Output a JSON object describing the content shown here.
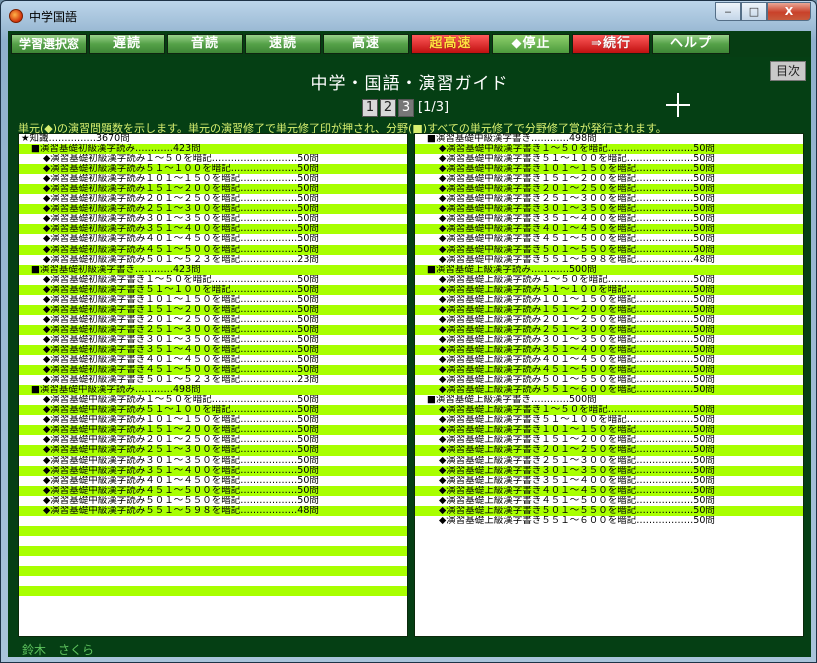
{
  "window": {
    "title": "中学国語",
    "min": "‒",
    "max": "□",
    "close": "X"
  },
  "toolbar": [
    "学習選択窓",
    "遅読",
    "音読",
    "速読",
    "高速",
    "超高速",
    "◆停止",
    "⇒続行",
    "ヘルプ"
  ],
  "heading": "中学・国語・演習ガイド",
  "next_label": "目次",
  "pages": [
    "1",
    "2",
    "3"
  ],
  "page_indicator": "[1/3]",
  "info": "単元(◆)の演習問題数を示します。単元の演習修了で単元修了印が押され、分野(■)すべての単元修了で分野修了賞が発行されます。",
  "left_rows": [
    {
      "t": "★知識……………3670問",
      "k": "cat",
      "h": false
    },
    {
      "t": "■演習基礎初級漢字読み…………423問",
      "k": "sec",
      "h": true
    },
    {
      "t": "◆演習基礎初級漢字読み１～５０を暗記………………………50問",
      "k": "item",
      "h": false
    },
    {
      "t": "◆演習基礎初級漢字読み５１～１００を暗記…………………50問",
      "k": "item",
      "h": true
    },
    {
      "t": "◆演習基礎初級漢字読み１０１～１５０を暗記………………50問",
      "k": "item",
      "h": false
    },
    {
      "t": "◆演習基礎初級漢字読み１５１～２００を暗記………………50問",
      "k": "item",
      "h": true
    },
    {
      "t": "◆演習基礎初級漢字読み２０１～２５０を暗記………………50問",
      "k": "item",
      "h": false
    },
    {
      "t": "◆演習基礎初級漢字読み２５１～３００を暗記………………50問",
      "k": "item",
      "h": true
    },
    {
      "t": "◆演習基礎初級漢字読み３０１～３５０を暗記………………50問",
      "k": "item",
      "h": false
    },
    {
      "t": "◆演習基礎初級漢字読み３５１～４００を暗記………………50問",
      "k": "item",
      "h": true
    },
    {
      "t": "◆演習基礎初級漢字読み４０１～４５０を暗記………………50問",
      "k": "item",
      "h": false
    },
    {
      "t": "◆演習基礎初級漢字読み４５１～５００を暗記………………50問",
      "k": "item",
      "h": true
    },
    {
      "t": "◆演習基礎初級漢字読み５０１～５２３を暗記………………23問",
      "k": "item",
      "h": false
    },
    {
      "t": "■演習基礎初級漢字書き…………423問",
      "k": "sec",
      "h": true
    },
    {
      "t": "◆演習基礎初級漢字書き１～５０を暗記………………………50問",
      "k": "item",
      "h": false
    },
    {
      "t": "◆演習基礎初級漢字書き５１～１００を暗記…………………50問",
      "k": "item",
      "h": true
    },
    {
      "t": "◆演習基礎初級漢字書き１０１～１５０を暗記………………50問",
      "k": "item",
      "h": false
    },
    {
      "t": "◆演習基礎初級漢字書き１５１～２００を暗記………………50問",
      "k": "item",
      "h": true
    },
    {
      "t": "◆演習基礎初級漢字書き２０１～２５０を暗記………………50問",
      "k": "item",
      "h": false
    },
    {
      "t": "◆演習基礎初級漢字書き２５１～３００を暗記………………50問",
      "k": "item",
      "h": true
    },
    {
      "t": "◆演習基礎初級漢字書き３０１～３５０を暗記………………50問",
      "k": "item",
      "h": false
    },
    {
      "t": "◆演習基礎初級漢字書き３５１～４００を暗記………………50問",
      "k": "item",
      "h": true
    },
    {
      "t": "◆演習基礎初級漢字書き４０１～４５０を暗記………………50問",
      "k": "item",
      "h": false
    },
    {
      "t": "◆演習基礎初級漢字書き４５１～５００を暗記………………50問",
      "k": "item",
      "h": true
    },
    {
      "t": "◆演習基礎初級漢字書き５０１～５２３を暗記………………23問",
      "k": "item",
      "h": false
    },
    {
      "t": "■演習基礎中級漢字読み…………498問",
      "k": "sec",
      "h": true
    },
    {
      "t": "◆演習基礎中級漢字読み１～５０を暗記………………………50問",
      "k": "item",
      "h": false
    },
    {
      "t": "◆演習基礎中級漢字読み５１～１００を暗記…………………50問",
      "k": "item",
      "h": true
    },
    {
      "t": "◆演習基礎中級漢字読み１０１～１５０を暗記………………50問",
      "k": "item",
      "h": false
    },
    {
      "t": "◆演習基礎中級漢字読み１５１～２００を暗記………………50問",
      "k": "item",
      "h": true
    },
    {
      "t": "◆演習基礎中級漢字読み２０１～２５０を暗記………………50問",
      "k": "item",
      "h": false
    },
    {
      "t": "◆演習基礎中級漢字読み２５１～３００を暗記………………50問",
      "k": "item",
      "h": true
    },
    {
      "t": "◆演習基礎中級漢字読み３０１～３５０を暗記………………50問",
      "k": "item",
      "h": false
    },
    {
      "t": "◆演習基礎中級漢字読み３５１～４００を暗記………………50問",
      "k": "item",
      "h": true
    },
    {
      "t": "◆演習基礎中級漢字読み４０１～４５０を暗記………………50問",
      "k": "item",
      "h": false
    },
    {
      "t": "◆演習基礎中級漢字読み４５１～５００を暗記………………50問",
      "k": "item",
      "h": true
    },
    {
      "t": "◆演習基礎中級漢字読み５０１～５５０を暗記………………50問",
      "k": "item",
      "h": false
    },
    {
      "t": "◆演習基礎中級漢字読み５５１～５９８を暗記………………48問",
      "k": "item",
      "h": true
    },
    {
      "t": "",
      "k": "item",
      "h": false
    },
    {
      "t": "",
      "k": "item",
      "h": true
    },
    {
      "t": "",
      "k": "item",
      "h": false
    },
    {
      "t": "",
      "k": "item",
      "h": true
    },
    {
      "t": "",
      "k": "item",
      "h": false
    },
    {
      "t": "",
      "k": "item",
      "h": true
    },
    {
      "t": "",
      "k": "item",
      "h": false
    },
    {
      "t": "",
      "k": "item",
      "h": true
    }
  ],
  "right_rows": [
    {
      "t": "■演習基礎中級漢字書き…………498問",
      "k": "sec",
      "h": false
    },
    {
      "t": "◆演習基礎中級漢字書き１～５０を暗記………………………50問",
      "k": "item",
      "h": true
    },
    {
      "t": "◆演習基礎中級漢字書き５１～１００を暗記…………………50問",
      "k": "item",
      "h": false
    },
    {
      "t": "◆演習基礎中級漢字書き１０１～１５０を暗記………………50問",
      "k": "item",
      "h": true
    },
    {
      "t": "◆演習基礎中級漢字書き１５１～２００を暗記………………50問",
      "k": "item",
      "h": false
    },
    {
      "t": "◆演習基礎中級漢字書き２０１～２５０を暗記………………50問",
      "k": "item",
      "h": true
    },
    {
      "t": "◆演習基礎中級漢字書き２５１～３００を暗記………………50問",
      "k": "item",
      "h": false
    },
    {
      "t": "◆演習基礎中級漢字書き３０１～３５０を暗記………………50問",
      "k": "item",
      "h": true
    },
    {
      "t": "◆演習基礎中級漢字書き３５１～４００を暗記………………50問",
      "k": "item",
      "h": false
    },
    {
      "t": "◆演習基礎中級漢字書き４０１～４５０を暗記………………50問",
      "k": "item",
      "h": true
    },
    {
      "t": "◆演習基礎中級漢字書き４５１～５００を暗記………………50問",
      "k": "item",
      "h": false
    },
    {
      "t": "◆演習基礎中級漢字書き５０１～５５０を暗記………………50問",
      "k": "item",
      "h": true
    },
    {
      "t": "◆演習基礎中級漢字書き５５１～５９８を暗記………………48問",
      "k": "item",
      "h": false
    },
    {
      "t": "■演習基礎上級漢字読み…………500問",
      "k": "sec",
      "h": true
    },
    {
      "t": "◆演習基礎上級漢字読み１～５０を暗記………………………50問",
      "k": "item",
      "h": false
    },
    {
      "t": "◆演習基礎上級漢字読み５１～１００を暗記…………………50問",
      "k": "item",
      "h": true
    },
    {
      "t": "◆演習基礎上級漢字読み１０１～１５０を暗記………………50問",
      "k": "item",
      "h": false
    },
    {
      "t": "◆演習基礎上級漢字読み１５１～２００を暗記………………50問",
      "k": "item",
      "h": true
    },
    {
      "t": "◆演習基礎上級漢字読み２０１～２５０を暗記………………50問",
      "k": "item",
      "h": false
    },
    {
      "t": "◆演習基礎上級漢字読み２５１～３００を暗記………………50問",
      "k": "item",
      "h": true
    },
    {
      "t": "◆演習基礎上級漢字読み３０１～３５０を暗記………………50問",
      "k": "item",
      "h": false
    },
    {
      "t": "◆演習基礎上級漢字読み３５１～４００を暗記………………50問",
      "k": "item",
      "h": true
    },
    {
      "t": "◆演習基礎上級漢字読み４０１～４５０を暗記………………50問",
      "k": "item",
      "h": false
    },
    {
      "t": "◆演習基礎上級漢字読み４５１～５００を暗記………………50問",
      "k": "item",
      "h": true
    },
    {
      "t": "◆演習基礎上級漢字読み５０１～５５０を暗記………………50問",
      "k": "item",
      "h": false
    },
    {
      "t": "◆演習基礎上級漢字読み５５１～６００を暗記………………50問",
      "k": "item",
      "h": true
    },
    {
      "t": "■演習基礎上級漢字書き…………500問",
      "k": "sec",
      "h": false
    },
    {
      "t": "◆演習基礎上級漢字書き１～５０を暗記………………………50問",
      "k": "item",
      "h": true
    },
    {
      "t": "◆演習基礎上級漢字書き５１～１００を暗記…………………50問",
      "k": "item",
      "h": false
    },
    {
      "t": "◆演習基礎上級漢字書き１０１～１５０を暗記………………50問",
      "k": "item",
      "h": true
    },
    {
      "t": "◆演習基礎上級漢字書き１５１～２００を暗記………………50問",
      "k": "item",
      "h": false
    },
    {
      "t": "◆演習基礎上級漢字書き２０１～２５０を暗記………………50問",
      "k": "item",
      "h": true
    },
    {
      "t": "◆演習基礎上級漢字書き２５１～３００を暗記………………50問",
      "k": "item",
      "h": false
    },
    {
      "t": "◆演習基礎上級漢字書き３０１～３５０を暗記………………50問",
      "k": "item",
      "h": true
    },
    {
      "t": "◆演習基礎上級漢字書き３５１～４００を暗記………………50問",
      "k": "item",
      "h": false
    },
    {
      "t": "◆演習基礎上級漢字書き４０１～４５０を暗記………………50問",
      "k": "item",
      "h": true
    },
    {
      "t": "◆演習基礎上級漢字書き４５１～５００を暗記………………50問",
      "k": "item",
      "h": false
    },
    {
      "t": "◆演習基礎上級漢字書き５０１～５５０を暗記………………50問",
      "k": "item",
      "h": true
    },
    {
      "t": "◆演習基礎上級漢字書き５５１～６００を暗記………………50問",
      "k": "item",
      "h": false
    }
  ],
  "footer_user": "鈴木　さくら"
}
